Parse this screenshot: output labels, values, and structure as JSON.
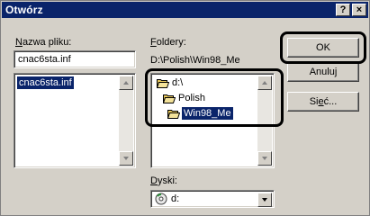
{
  "window": {
    "title": "Otwórz",
    "help_label": "?",
    "close_label": "×"
  },
  "filename": {
    "label_underlined": "N",
    "label_rest": "azwa pliku:",
    "value": "cnac6sta.inf",
    "list": [
      "cnac6sta.inf"
    ]
  },
  "folders": {
    "label_underlined": "F",
    "label_rest": "oldery:",
    "current_path": "D:\\Polish\\Win98_Me",
    "items": [
      {
        "label": "d:\\",
        "state": "open"
      },
      {
        "label": "Polish",
        "state": "open"
      },
      {
        "label": "Win98_Me",
        "state": "open-selected"
      }
    ]
  },
  "drives": {
    "label_underlined": "D",
    "label_rest": "yski:",
    "selected": "d:"
  },
  "buttons": {
    "ok": "OK",
    "cancel": "Anuluj",
    "network_pre": "Si",
    "network_underlined": "e",
    "network_post": "ć..."
  },
  "colors": {
    "titlebar": "#0a246a",
    "dialog_face": "#d4d0c8",
    "selection": "#0a246a"
  }
}
